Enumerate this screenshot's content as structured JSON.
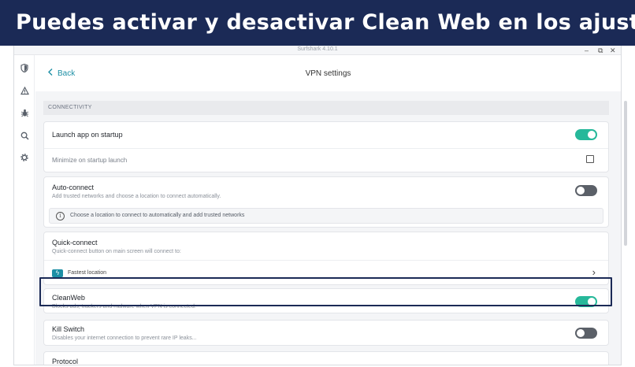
{
  "banner": {
    "text": "Puedes activar y desactivar Clean Web en los ajustes"
  },
  "window": {
    "title": "Surfshark 4.10.1",
    "minimize": "–",
    "restore": "⧉",
    "close": "✕"
  },
  "sidebar": {
    "icons": [
      "shield-icon",
      "alert-icon",
      "bug-icon",
      "search-icon",
      "gear-icon"
    ]
  },
  "header": {
    "back_label": "Back",
    "title": "VPN settings"
  },
  "section": {
    "label": "CONNECTIVITY"
  },
  "launch": {
    "title": "Launch app on startup",
    "enabled": true,
    "minimize_label": "Minimize on startup launch",
    "minimize_checked": false
  },
  "autoconnect": {
    "title": "Auto-connect",
    "subtitle": "Add trusted networks and choose a location to connect automatically.",
    "enabled": false,
    "info": "Choose a location to connect to automatically and add trusted networks"
  },
  "quickconnect": {
    "title": "Quick-connect",
    "subtitle": "Quick-connect button on main screen will connect to:",
    "option": "Fastest location"
  },
  "cleanweb": {
    "title": "CleanWeb",
    "subtitle": "Blocks ads, trackers and malware when VPN is connected.",
    "enabled": true
  },
  "killswitch": {
    "title": "Kill Switch",
    "subtitle": "Disables your internet connection to prevent rare IP leaks...",
    "enabled": false
  },
  "protocol": {
    "title": "Protocol"
  },
  "colors": {
    "accent": "#26b89a",
    "link": "#1d8fa5",
    "banner": "#1b2a56"
  }
}
